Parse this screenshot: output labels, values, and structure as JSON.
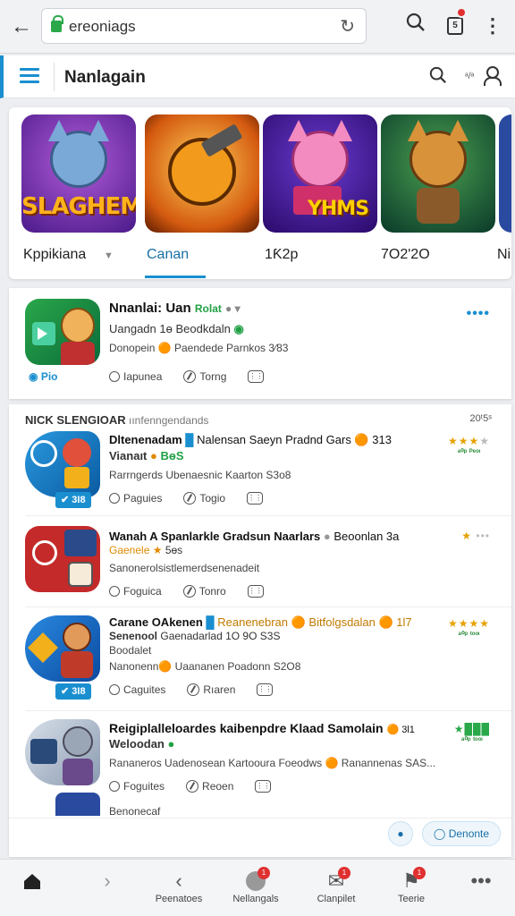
{
  "browser": {
    "url": "ereoniags",
    "icons": [
      "back-arrow-icon",
      "lock-icon",
      "reload-icon",
      "search-icon",
      "tabs-icon",
      "more-vert-icon"
    ]
  },
  "header": {
    "title": "Nanlagain",
    "small": "ᵃ/ᵃ"
  },
  "featured": {
    "tiles": [
      {
        "word": "SLAGHEM",
        "label": "Kppikiana"
      },
      {
        "word": "",
        "label": "Canan"
      },
      {
        "word": "YHMS",
        "label": "1Ƙ2p"
      },
      {
        "word": "",
        "label": "7O2ʹ2O"
      },
      {
        "word": "",
        "label": "Ni"
      }
    ]
  },
  "top_card": {
    "title": "Nnanlai: Uan",
    "title_tag": "Rolat",
    "line2": "Uangadn 1ɵ Beodkdaln",
    "line3": "Donopein 🟠 Paendede Parnkos 3⁄83",
    "badge": "Pio",
    "actions": [
      "Iapunea",
      "Torng",
      ""
    ]
  },
  "section": {
    "title": "NICK SLENGIOAR",
    "subtitle": "ıınfenngendands",
    "right": "20ᵗ5ˢ"
  },
  "list": [
    {
      "title": "Dltenenadam",
      "title_rest": "Nalensan Saeyn Pradnd Gars 🟠 313",
      "line2": "Vianaıt",
      "line2_tag": "BɵS",
      "meta": "Rarrngerds Ubenaesnic Kaarton S3o8",
      "badge": "3Ɩ8",
      "actions": [
        "Paguies",
        "Togio",
        ""
      ],
      "stars": 4,
      "rating_text": "ᵃ⁰ᵖ ᴾᵉᵒᶦ"
    },
    {
      "title": "Wanah A Spanlarkle Gradsun Naarlars",
      "title_rest": "Beoonlan 3a",
      "line2": "Gaenele",
      "line2_tag": "5ɵs",
      "meta": "Sanonerolsistlemerdsenenadeit",
      "badge": "",
      "actions": [
        "Foguica",
        "Tonro",
        ""
      ],
      "stars": 1,
      "rating_text": ""
    },
    {
      "title": "Carane OAkenen",
      "title_rest": "Reanenebran 🟠 Bitfolgsdalan 🟠 1Ɩ7",
      "line2": "Senenool",
      "line2_tag": "Gaenadarlad 1O 9O S3S",
      "meta": "Nanonenn🟠 Uaananen Poadonn S2O8",
      "extra": "Boodalet",
      "badge": "3Ɩ8",
      "actions": [
        "Caguites",
        "Rıaren",
        ""
      ],
      "stars": 4,
      "rating_text": "ᵃ⁰ᵖ ᵗᵒᵒᶦ"
    },
    {
      "title": "Reigiplalleloardes kaibenpdre Klaad Samolain",
      "title_rest": "🟠 3Ɩ1",
      "line2": "Weloodan",
      "line2_tag": "",
      "meta": "Rananeros Uadenosean Kartooura Foeodws 🟠 Ranannenas SAS...",
      "badge": "",
      "actions": [
        "Foguites",
        "Reoen",
        ""
      ],
      "stars": 4,
      "rating_text": "ᵃ⁰ᵖ ᵗᵒᵒᶦ"
    }
  ],
  "peek": {
    "label": "Benonecaf"
  },
  "float_buttons": {
    "left_icon": "mic-icon",
    "right_label": "Denonte"
  },
  "nav": [
    {
      "label": "",
      "icon": "home-icon"
    },
    {
      "label": "",
      "icon": "chevron-right-icon"
    },
    {
      "label": "Peenatoes",
      "icon": "chevron-left-icon"
    },
    {
      "label": "Nellangals",
      "icon": "avatar-icon",
      "badge": "1"
    },
    {
      "label": "Clanpilet",
      "icon": "mail-icon",
      "badge": "1"
    },
    {
      "label": "Teerie",
      "icon": "bookmark-icon",
      "badge": "1"
    },
    {
      "label": "",
      "icon": "more-horiz-icon"
    }
  ],
  "colors": {
    "accent": "#1a8fd0",
    "green": "#22a045",
    "star": "#e6a200",
    "badge_red": "#e03030"
  }
}
